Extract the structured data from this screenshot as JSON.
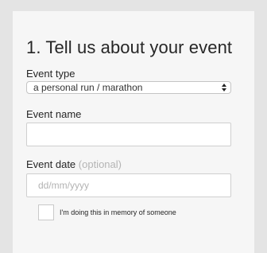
{
  "form": {
    "title": "1. Tell us about your event",
    "event_type": {
      "label": "Event type",
      "selected_value": "a personal run / marathon",
      "arrow_icon": "up-down-arrows-icon"
    },
    "event_name": {
      "label": "Event name",
      "value": "",
      "placeholder": ""
    },
    "event_date": {
      "label": "Event date",
      "optional_note": "(optional)",
      "value": "",
      "placeholder": "dd/mm/yyyy"
    },
    "memory_checkbox": {
      "checked": false,
      "label": "I'm doing this in memory of someone"
    }
  },
  "colors": {
    "page_background": "#e4e4e4",
    "card_background": "#f6f6f6",
    "text": "#262626",
    "muted_text": "#b5b5b5",
    "border": "#c4c4c4"
  }
}
